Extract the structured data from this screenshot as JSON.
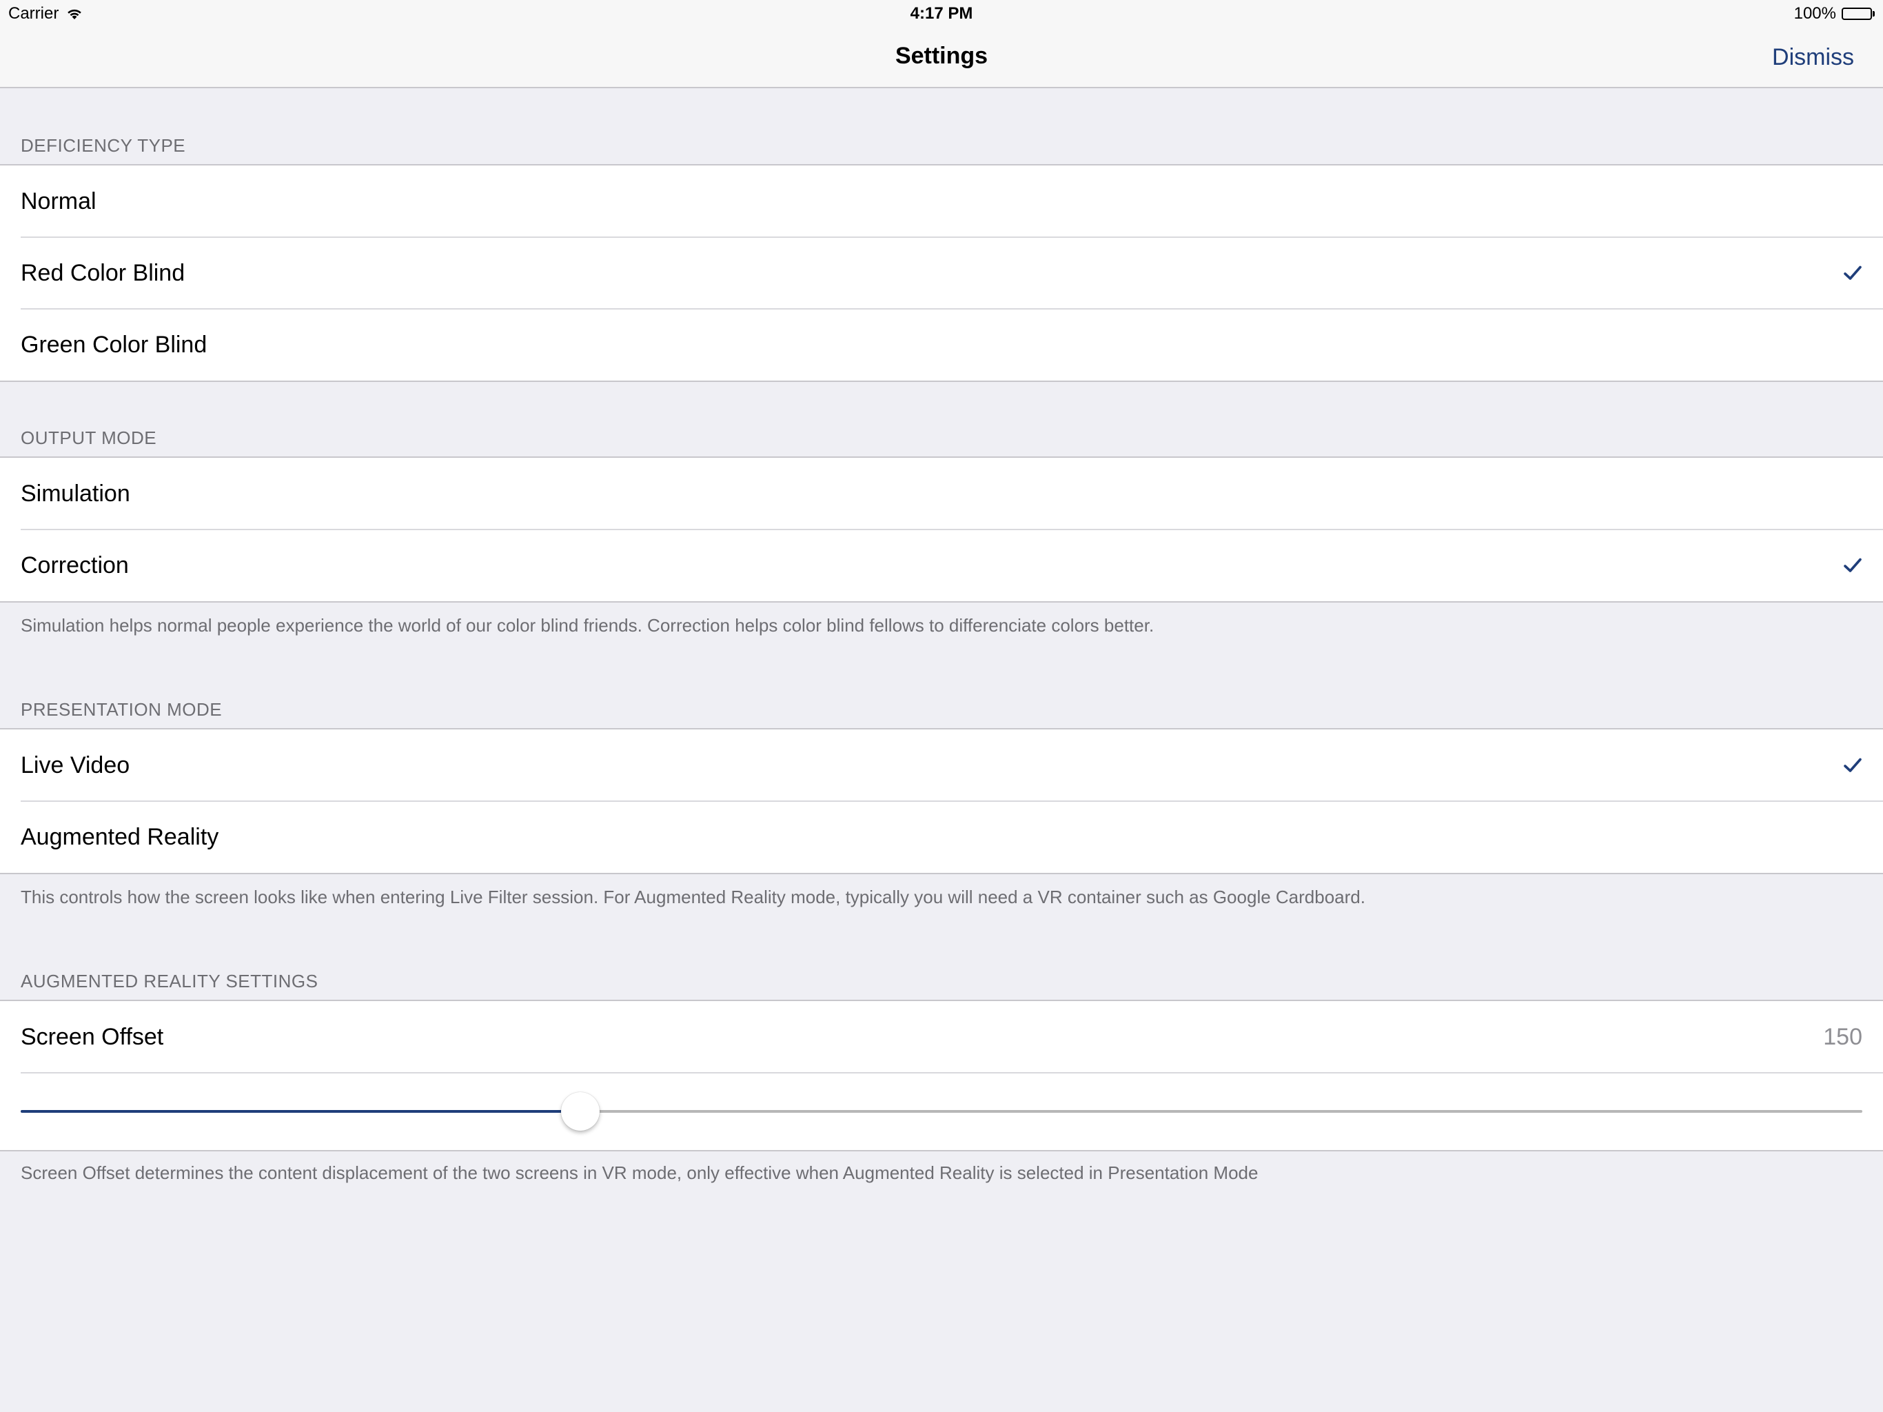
{
  "status_bar": {
    "carrier": "Carrier",
    "time": "4:17 PM",
    "battery": "100%"
  },
  "nav": {
    "title": "Settings",
    "dismiss_label": "Dismiss"
  },
  "accent_color": "#1f3e7a",
  "sections": {
    "deficiency": {
      "header": "DEFICIENCY TYPE",
      "items": [
        {
          "label": "Normal",
          "checked": false
        },
        {
          "label": "Red Color Blind",
          "checked": true
        },
        {
          "label": "Green Color Blind",
          "checked": false
        }
      ]
    },
    "output": {
      "header": "OUTPUT MODE",
      "items": [
        {
          "label": "Simulation",
          "checked": false
        },
        {
          "label": "Correction",
          "checked": true
        }
      ],
      "footer": "Simulation helps normal people experience the world of our color blind friends. Correction helps color blind fellows to differenciate colors better."
    },
    "presentation": {
      "header": "PRESENTATION MODE",
      "items": [
        {
          "label": "Live Video",
          "checked": true
        },
        {
          "label": "Augmented Reality",
          "checked": false
        }
      ],
      "footer": "This controls how the screen looks like when entering Live Filter session. For Augmented Reality mode, typically you will need a VR container such as Google Cardboard."
    },
    "ar_settings": {
      "header": "AUGMENTED REALITY SETTINGS",
      "offset_label": "Screen Offset",
      "offset_value": "150",
      "slider_fraction": 0.304,
      "footer": "Screen Offset determines the content displacement of the two screens in VR mode, only effective when Augmented Reality is selected in Presentation Mode"
    }
  }
}
